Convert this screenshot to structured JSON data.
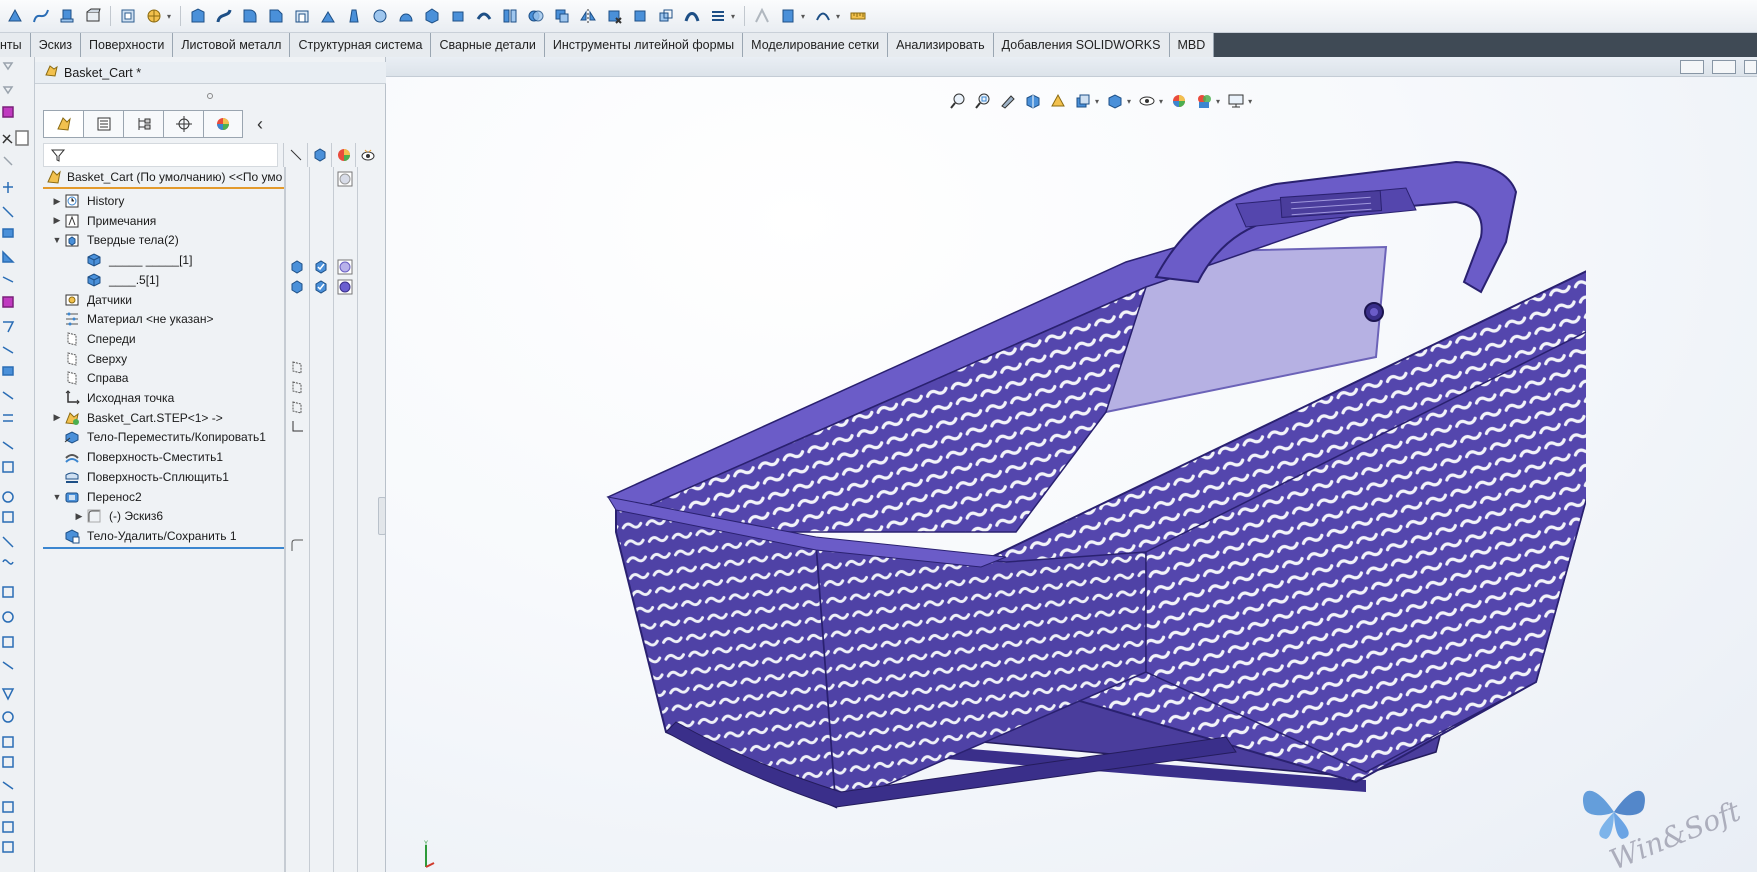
{
  "toolbar": {
    "icons": [
      "sketch-tool-icon",
      "curve-tool-icon",
      "extrude-icon",
      "boss-icon",
      "cut-icon",
      "pattern-icon",
      "sweep-icon",
      "loft-icon",
      "fillet-icon",
      "chamfer-icon",
      "shell-icon",
      "rib-icon",
      "draft-icon",
      "wrap-icon",
      "dome-icon",
      "revolve-icon",
      "move-face-icon",
      "thicken-icon",
      "split-icon",
      "combine-icon",
      "intersect-icon",
      "mirror-icon",
      "delete-body-icon",
      "move-body-icon",
      "scale-icon",
      "flex-icon",
      "indent-icon",
      "deform-icon",
      "freeform-icon",
      "measure-icon"
    ]
  },
  "tabs": [
    "нты",
    "Эскиз",
    "Поверхности",
    "Листовой металл",
    "Структурная система",
    "Сварные детали",
    "Инструменты литейной формы",
    "Моделирование сетки",
    "Анализировать",
    "Добавления SOLIDWORKS",
    "MBD"
  ],
  "document": {
    "title": "Basket_Cart *"
  },
  "tree": {
    "root_label": "Basket_Cart  (По умолчанию) <<По умо",
    "items": [
      {
        "label": "History",
        "indent": 0,
        "expander": "▶",
        "icon": "history-icon"
      },
      {
        "label": "Примечания",
        "indent": 0,
        "expander": "▶",
        "icon": "annotations-icon"
      },
      {
        "label": "Твердые тела(2)",
        "indent": 0,
        "expander": "▼",
        "icon": "solid-bodies-folder-icon"
      },
      {
        "label": "_____ _____[1]",
        "indent": 1,
        "expander": "",
        "icon": "solid-body-icon"
      },
      {
        "label": "____.5[1]",
        "indent": 1,
        "expander": "",
        "icon": "solid-body-icon"
      },
      {
        "label": "Датчики",
        "indent": 0,
        "expander": "",
        "icon": "sensors-icon"
      },
      {
        "label": "Материал <не указан>",
        "indent": 0,
        "expander": "",
        "icon": "material-icon"
      },
      {
        "label": "Спереди",
        "indent": 0,
        "expander": "",
        "icon": "plane-icon"
      },
      {
        "label": "Сверху",
        "indent": 0,
        "expander": "",
        "icon": "plane-icon"
      },
      {
        "label": "Справа",
        "indent": 0,
        "expander": "",
        "icon": "plane-icon"
      },
      {
        "label": "Исходная точка",
        "indent": 0,
        "expander": "",
        "icon": "origin-icon"
      },
      {
        "label": "Basket_Cart.STEP<1> ->",
        "indent": 0,
        "expander": "▶",
        "icon": "imported-part-icon"
      },
      {
        "label": "Тело-Переместить/Копировать1",
        "indent": 0,
        "expander": "",
        "icon": "move-copy-body-icon"
      },
      {
        "label": "Поверхность-Сместить1",
        "indent": 0,
        "expander": "",
        "icon": "offset-surface-icon"
      },
      {
        "label": "Поверхность-Сплющить1",
        "indent": 0,
        "expander": "",
        "icon": "flatten-surface-icon"
      },
      {
        "label": "Перенос2",
        "indent": 0,
        "expander": "▼",
        "icon": "wrap-feature-icon"
      },
      {
        "label": "(-) Эскиз6",
        "indent": 1,
        "expander": "▶",
        "icon": "sketch-icon"
      },
      {
        "label": "Тело-Удалить/Сохранить 1",
        "indent": 0,
        "expander": "",
        "icon": "delete-keep-body-icon"
      }
    ]
  },
  "colors": {
    "model_purple": "#5a4cb5",
    "model_dark": "#3a2f8a",
    "rollback_bar": "#3b86d0",
    "root_underline": "#e39a2c",
    "tab_bar_bg": "#3f4a55"
  },
  "watermark": {
    "text": "Win&Soft"
  },
  "triad": {
    "axis_label": "Y"
  }
}
